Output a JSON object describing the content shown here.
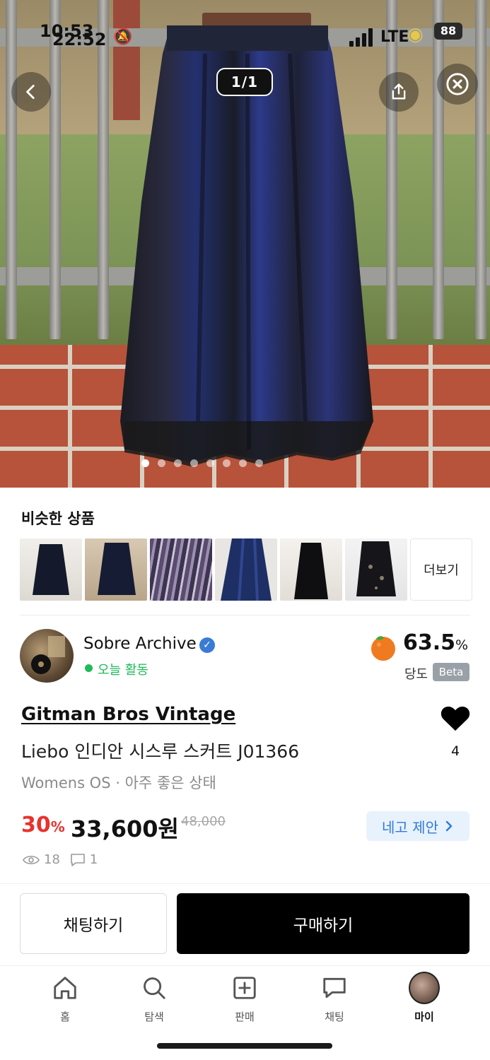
{
  "status_bar": {
    "time_back": "10:53",
    "time_front": "22:52",
    "network": "LTE",
    "battery": "88"
  },
  "image_viewer": {
    "counter": "1/1",
    "dots_count": 8,
    "active_dot": 0
  },
  "similar": {
    "title": "비슷한 상품",
    "more_label": "더보기",
    "thumbnails": [
      "navy-skirt",
      "navy-skirt-hanger",
      "purple-print-skirt",
      "blue-satin-skirt",
      "black-skirt",
      "lace-skirt"
    ]
  },
  "seller": {
    "name": "Sobre Archive",
    "activity": "오늘 활동",
    "sweetness_value": "63.5",
    "sweetness_unit": "%",
    "sweetness_label": "당도",
    "beta_label": "Beta"
  },
  "product": {
    "brand": "Gitman Bros Vintage",
    "title": "Liebo 인디안 시스루 스커트 J01366",
    "meta": "Womens OS · 아주 좋은 상태",
    "discount_value": "30",
    "discount_unit": "%",
    "price": "33,600원",
    "original_price": "48,000",
    "offer_label": "네고 제안",
    "likes": "4",
    "views": "18",
    "comments": "1"
  },
  "actions": {
    "chat_label": "채팅하기",
    "buy_label": "구매하기"
  },
  "tabs": [
    {
      "label": "홈",
      "icon": "home-icon"
    },
    {
      "label": "탐색",
      "icon": "search-icon"
    },
    {
      "label": "판매",
      "icon": "plus-square-icon"
    },
    {
      "label": "채팅",
      "icon": "chat-bubble-icon"
    },
    {
      "label": "마이",
      "icon": "profile-avatar"
    }
  ],
  "colors": {
    "accent_red": "#e8322e",
    "offer_blue": "#2f7ad8",
    "active_green": "#1fba5a"
  }
}
